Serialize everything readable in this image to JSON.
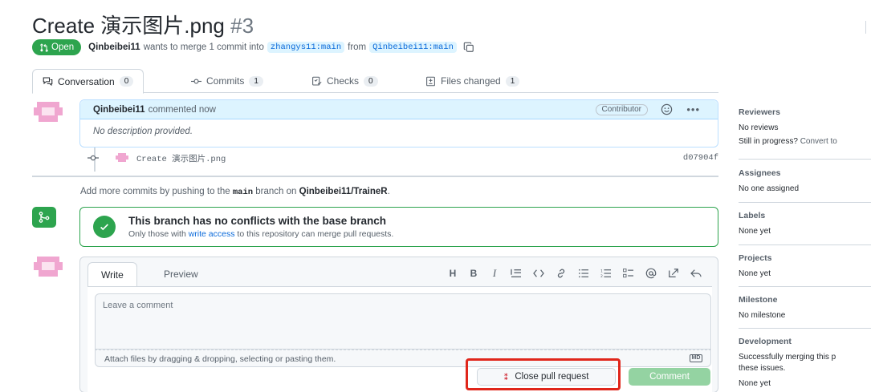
{
  "pr": {
    "title": "Create 演示图片.png",
    "number": "#3",
    "state": "Open",
    "author": "Qinbeibei11",
    "merge_text_1": "wants to merge 1 commit into",
    "base_branch": "zhangys11:main",
    "merge_text_2": "from",
    "head_branch": "Qinbeibei11:main"
  },
  "tabs": [
    {
      "label": "Conversation",
      "count": "0"
    },
    {
      "label": "Commits",
      "count": "1"
    },
    {
      "label": "Checks",
      "count": "0"
    },
    {
      "label": "Files changed",
      "count": "1"
    }
  ],
  "comment": {
    "author": "Qinbeibei11",
    "action": "commented now",
    "badge": "Contributor",
    "body": "No description provided."
  },
  "commit": {
    "message": "Create 演示图片.png",
    "sha": "d07904f"
  },
  "add_commits": {
    "prefix": "Add more commits by pushing to the",
    "branch": "main",
    "middle": "branch on",
    "repo": "Qinbeibei11/TraineR",
    "suffix": "."
  },
  "merge_status": {
    "title": "This branch has no conflicts with the base branch",
    "sub_prefix": "Only those with",
    "sub_link": "write access",
    "sub_suffix": "to this repository can merge pull requests."
  },
  "editor": {
    "write_tab": "Write",
    "preview_tab": "Preview",
    "placeholder": "Leave a comment",
    "attach_text": "Attach files by dragging & dropping, selecting or pasting them.",
    "toolbar": [
      "H",
      "B",
      "I"
    ],
    "md_badge": "MD"
  },
  "actions": {
    "close_label": "Close pull request",
    "comment_label": "Comment"
  },
  "sidebar": {
    "reviewers": {
      "heading": "Reviewers",
      "line1": "No reviews",
      "line2": "Still in progress?",
      "line2_link": "Convert to"
    },
    "assignees": {
      "heading": "Assignees",
      "value": "No one assigned"
    },
    "labels": {
      "heading": "Labels",
      "value": "None yet"
    },
    "projects": {
      "heading": "Projects",
      "value": "None yet"
    },
    "milestone": {
      "heading": "Milestone",
      "value": "No milestone"
    },
    "development": {
      "heading": "Development",
      "line1": "Successfully merging this p",
      "line2": "these issues.",
      "line3": "None yet"
    }
  },
  "colors": {
    "open_green": "#2da44e",
    "link_blue": "#0969da",
    "highlight_red": "#e0261b",
    "avatar_pink": "#f0a6d0"
  }
}
